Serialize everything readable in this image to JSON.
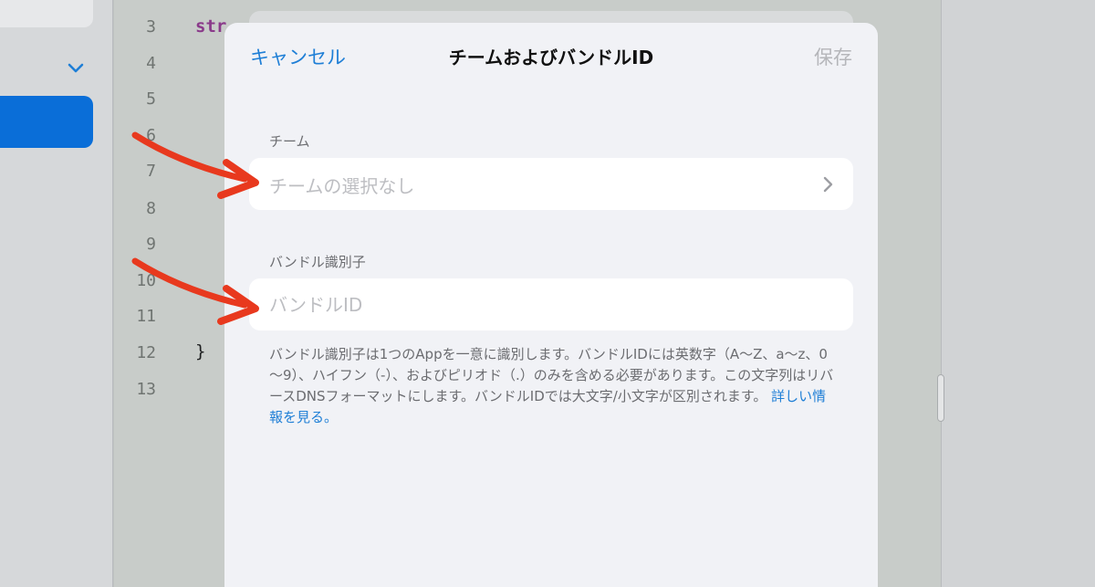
{
  "editor": {
    "line_numbers": [
      "3",
      "4",
      "5",
      "6",
      "7",
      "8",
      "9",
      "10",
      "11",
      "12",
      "13"
    ],
    "keyword_fragment": "str",
    "closing_brace": "}"
  },
  "modal": {
    "cancel_label": "キャンセル",
    "title": "チームおよびバンドルID",
    "save_label": "保存",
    "team_section_label": "チーム",
    "team_value": "チームの選択なし",
    "bundle_section_label": "バンドル識別子",
    "bundle_placeholder": "バンドルID",
    "bundle_value": "",
    "footnote": "バンドル識別子は1つのAppを一意に識別します。バンドルIDには英数字（A～Z、a～z、0～9）、ハイフン（-）、およびピリオド（.）のみを含める必要があります。この文字列はリバースDNSフォーマットにします。バンドルIDでは大文字/小文字が区別されます。",
    "learn_more_link": "詳しい情報を見る。"
  },
  "colors": {
    "accent": "#1f7fd6",
    "sidebar_selection": "#0a6ed8",
    "annotation_arrow": "#e8391e"
  },
  "icons": {
    "team_row_chevron": "chevron-right-icon",
    "sidebar_disclosure": "chevron-down-icon"
  }
}
